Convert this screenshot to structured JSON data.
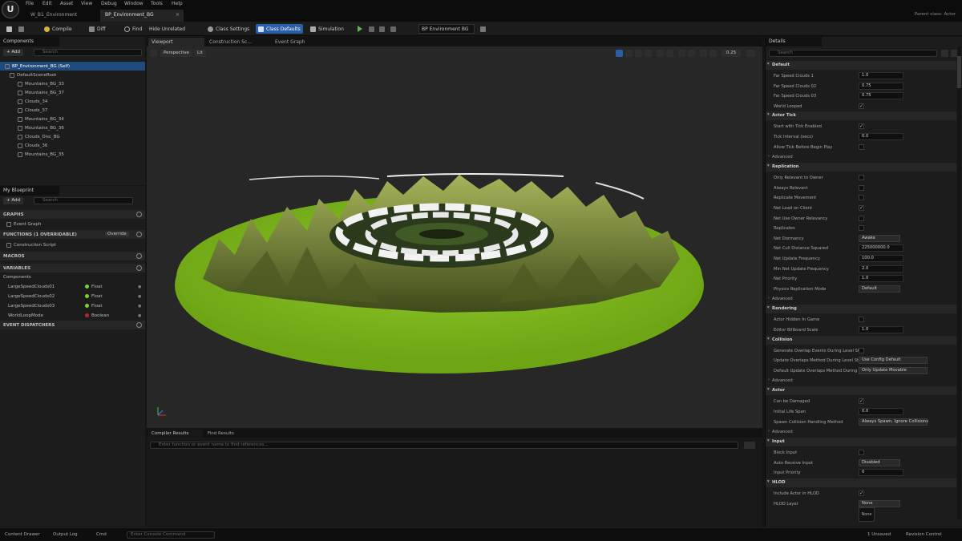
{
  "menu": [
    "File",
    "Edit",
    "Asset",
    "View",
    "Debug",
    "Window",
    "Tools",
    "Help"
  ],
  "tabs": [
    {
      "label": "W_B1_Environment"
    },
    {
      "label": "BP_Environment_BG"
    }
  ],
  "window_title": "Parent class: Actor",
  "toolbar": {
    "compile": "Compile",
    "diff": "Diff",
    "find": "Find",
    "hide_unrelated": "Hide Unrelated",
    "class_settings": "Class Settings",
    "class_defaults": "Class Defaults",
    "simulation": "Simulation",
    "debug_object": "BP Environment BG"
  },
  "components": {
    "title": "Components",
    "add": "+ Add",
    "search": "Search",
    "root": "BP_Environment_BG (Self)",
    "scene_root": "DefaultSceneRoot",
    "items": [
      "Mountains_BG_33",
      "Mountains_BG_37",
      "Clouds_34",
      "Clouds_37",
      "Mountains_BG_34",
      "Mountains_BG_36",
      "Clouds_Disc_BG",
      "Clouds_36",
      "Mountains_BG_35"
    ]
  },
  "blueprint": {
    "title": "My Blueprint",
    "add": "+ Add",
    "search": "Search",
    "graphs_hdr": "GRAPHS",
    "event_graph": "Event Graph",
    "functions_hdr": "FUNCTIONS (1 OVERRIDABLE)",
    "override": "Override",
    "construction": "Construction Script",
    "macros_hdr": "MACROS",
    "variables_hdr": "VARIABLES",
    "components_cat": "Components",
    "variables": [
      {
        "name": "LargeSpeedClouds01",
        "type": "Float",
        "color": "#7bd133"
      },
      {
        "name": "LargeSpeedClouds02",
        "type": "Float",
        "color": "#7bd133"
      },
      {
        "name": "LargeSpeedClouds03",
        "type": "Float",
        "color": "#7bd133"
      },
      {
        "name": "WorldLoopMode",
        "type": "Boolean",
        "color": "#b12b26"
      }
    ],
    "dispatchers_hdr": "EVENT DISPATCHERS"
  },
  "viewport": {
    "tabs": [
      "Viewport",
      "Construction Sc...",
      "Event Graph"
    ],
    "perspective": "Perspective",
    "lit": "Lit",
    "fov": "0.25"
  },
  "bottom": {
    "tabs": [
      "Compiler Results",
      "Find Results"
    ],
    "search_placeholder": "Enter function or event name to find references..."
  },
  "details": {
    "title": "Details",
    "search": "Search",
    "sections": [
      {
        "name": "Default",
        "rows": [
          {
            "label": "Far Speed Clouds 1",
            "kind": "val",
            "value": "1.0"
          },
          {
            "label": "Far Speed Clouds 02",
            "kind": "val",
            "value": "0.75"
          },
          {
            "label": "Far Speed Clouds 03",
            "kind": "val",
            "value": "0.75"
          },
          {
            "label": "World Looped",
            "kind": "chk",
            "value": "✓"
          }
        ]
      },
      {
        "name": "Actor Tick",
        "rows": [
          {
            "label": "Start with Tick Enabled",
            "kind": "chk",
            "value": "✓"
          },
          {
            "label": "Tick Interval (secs)",
            "kind": "val",
            "value": "0.0"
          },
          {
            "label": "Allow Tick Before Begin Play",
            "kind": "chk",
            "value": ""
          }
        ],
        "advanced": "Advanced"
      },
      {
        "name": "Replication",
        "rows": [
          {
            "label": "Only Relevant to Owner",
            "kind": "chk",
            "value": ""
          },
          {
            "label": "Always Relevant",
            "kind": "chk",
            "value": ""
          },
          {
            "label": "Replicate Movement",
            "kind": "chk",
            "value": ""
          },
          {
            "label": "Net Load on Client",
            "kind": "chk",
            "value": "✓"
          },
          {
            "label": "Net Use Owner Relevancy",
            "kind": "chk",
            "value": ""
          },
          {
            "label": "Replicates",
            "kind": "chk",
            "value": ""
          },
          {
            "label": "Net Dormancy",
            "kind": "dd",
            "value": "Awake"
          },
          {
            "label": "Net Cull Distance Squared",
            "kind": "val",
            "value": "225000000.0"
          },
          {
            "label": "Net Update Frequency",
            "kind": "val",
            "value": "100.0"
          },
          {
            "label": "Min Net Update Frequency",
            "kind": "val",
            "value": "2.0"
          },
          {
            "label": "Net Priority",
            "kind": "val",
            "value": "1.0"
          },
          {
            "label": "Physics Replication Mode",
            "kind": "dd",
            "value": "Default"
          }
        ],
        "advanced": "Advanced"
      },
      {
        "name": "Rendering",
        "rows": [
          {
            "label": "Actor Hidden In Game",
            "kind": "chk",
            "value": ""
          },
          {
            "label": "Editor Billboard Scale",
            "kind": "val",
            "value": "1.0"
          }
        ]
      },
      {
        "name": "Collision",
        "rows": [
          {
            "label": "Generate Overlap Events During Level Str...",
            "kind": "chk",
            "value": ""
          },
          {
            "label": "Update Overlaps Method During Level Str...",
            "kind": "dd",
            "value": "Use Config Default"
          },
          {
            "label": "Default Update Overlaps Method During L...",
            "kind": "dd",
            "value": "Only Update Movable"
          }
        ],
        "advanced": "Advanced"
      },
      {
        "name": "Actor",
        "rows": [
          {
            "label": "Can be Damaged",
            "kind": "chk",
            "value": "✓"
          },
          {
            "label": "Initial Life Span",
            "kind": "val",
            "value": "0.0"
          },
          {
            "label": "Spawn Collision Handling Method",
            "kind": "dd",
            "value": "Always Spawn, Ignore Collisions"
          }
        ],
        "advanced": "Advanced"
      },
      {
        "name": "Input",
        "rows": [
          {
            "label": "Block Input",
            "kind": "chk",
            "value": ""
          },
          {
            "label": "Auto Receive Input",
            "kind": "dd",
            "value": "Disabled"
          },
          {
            "label": "Input Priority",
            "kind": "val",
            "value": "0"
          }
        ]
      },
      {
        "name": "HLOD",
        "rows": [
          {
            "label": "Include Actor in HLOD",
            "kind": "chk",
            "value": "✓"
          },
          {
            "label": "HLOD Layer",
            "kind": "dd",
            "value": "None"
          }
        ]
      }
    ],
    "hlod_thumb": "None"
  },
  "status": {
    "content_drawer": "Content Drawer",
    "output_log": "Output Log",
    "cmd": "Cmd",
    "console_placeholder": "Enter Console Command",
    "unsaved": "1 Unsaved",
    "revision": "Revision Control"
  },
  "colors": {
    "accent": "#2a5fa8",
    "terrain": "#7db21a",
    "grid": "#272727"
  }
}
